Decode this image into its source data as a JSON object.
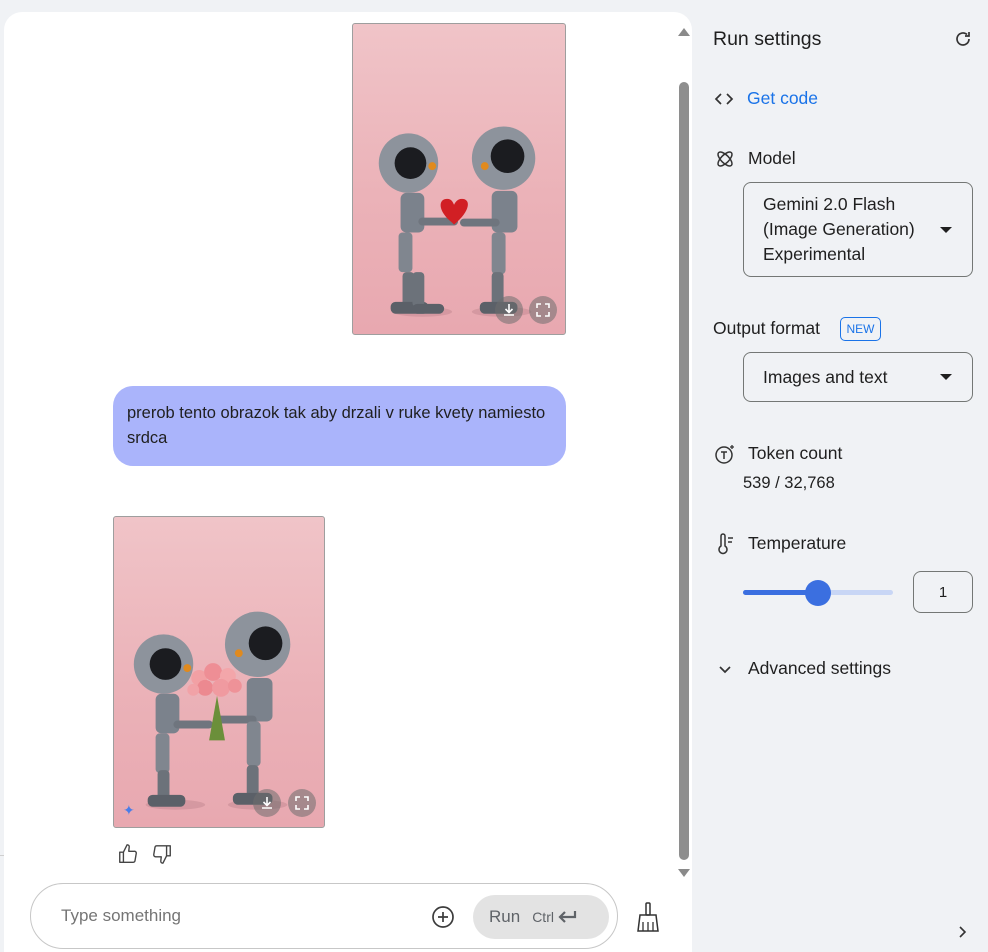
{
  "chat": {
    "user_message": "prerob tento obrazok tak aby drzali v ruke kvety namiesto srdca",
    "input_placeholder": "Type something",
    "run_label": "Run",
    "run_shortcut": "Ctrl"
  },
  "settings": {
    "title": "Run settings",
    "get_code": "Get code",
    "model_label": "Model",
    "model_value_line1": "Gemini 2.0 Flash",
    "model_value_line2": "(Image Generation)",
    "model_value_line3": "Experimental",
    "output_format_label": "Output format",
    "new_badge": "NEW",
    "output_format_value": "Images and text",
    "token_count_label": "Token count",
    "token_count_value": "539 / 32,768",
    "temperature_label": "Temperature",
    "temperature_value": "1",
    "temperature_fraction": 0.5,
    "advanced_label": "Advanced settings"
  },
  "colors": {
    "accent": "#1a73e8",
    "user_bubble": "#aab4fb",
    "slider": "#3b6fe0"
  }
}
